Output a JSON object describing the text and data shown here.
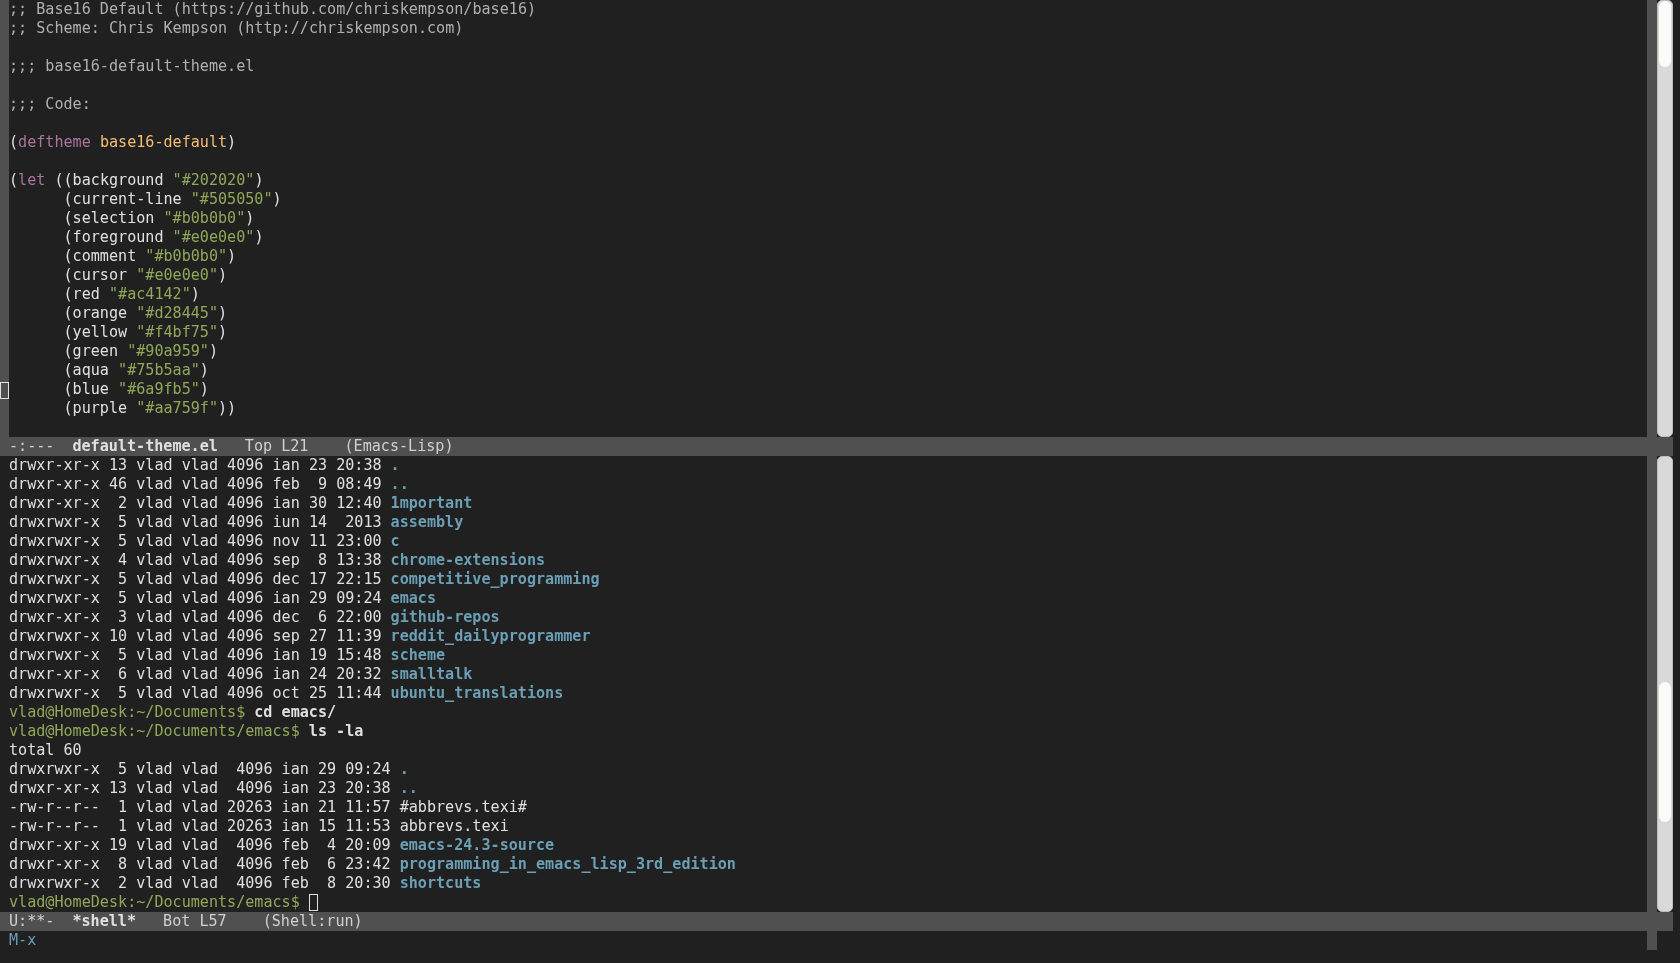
{
  "editor": {
    "lines": [
      {
        "kind": "code",
        "cursor": false,
        "segments": [
          {
            "kind": "comment",
            "text": ";; Base16 Default (https://github.com/chriskempson/base16)"
          }
        ]
      },
      {
        "kind": "code",
        "cursor": false,
        "segments": [
          {
            "kind": "comment",
            "text": ";; Scheme: Chris Kempson (http://chriskempson.com)"
          }
        ]
      },
      {
        "kind": "blank",
        "cursor": false
      },
      {
        "kind": "code",
        "cursor": false,
        "segments": [
          {
            "kind": "comment",
            "text": ";;; base16-default-theme.el"
          }
        ]
      },
      {
        "kind": "blank",
        "cursor": false
      },
      {
        "kind": "code",
        "cursor": false,
        "segments": [
          {
            "kind": "comment",
            "text": ";;; Code:"
          }
        ]
      },
      {
        "kind": "blank",
        "cursor": false
      },
      {
        "kind": "code",
        "cursor": false,
        "segments": [
          {
            "kind": "plain",
            "text": "("
          },
          {
            "kind": "keyword",
            "text": "deftheme"
          },
          {
            "kind": "name",
            "text": " base16-default"
          },
          {
            "kind": "plain",
            "text": ")"
          }
        ]
      },
      {
        "kind": "blank",
        "cursor": false
      },
      {
        "kind": "code",
        "cursor": false,
        "segments": [
          {
            "kind": "plain",
            "text": "("
          },
          {
            "kind": "keyword",
            "text": "let"
          },
          {
            "kind": "plain",
            "text": " ((background "
          },
          {
            "kind": "string",
            "text": "\"#202020\""
          },
          {
            "kind": "plain",
            "text": ")"
          }
        ]
      },
      {
        "kind": "code",
        "cursor": false,
        "segments": [
          {
            "kind": "plain",
            "text": "      (current-line "
          },
          {
            "kind": "string",
            "text": "\"#505050\""
          },
          {
            "kind": "plain",
            "text": ")"
          }
        ]
      },
      {
        "kind": "code",
        "cursor": false,
        "segments": [
          {
            "kind": "plain",
            "text": "      (selection "
          },
          {
            "kind": "string",
            "text": "\"#b0b0b0\""
          },
          {
            "kind": "plain",
            "text": ")"
          }
        ]
      },
      {
        "kind": "code",
        "cursor": false,
        "segments": [
          {
            "kind": "plain",
            "text": "      (foreground "
          },
          {
            "kind": "string",
            "text": "\"#e0e0e0\""
          },
          {
            "kind": "plain",
            "text": ")"
          }
        ]
      },
      {
        "kind": "code",
        "cursor": false,
        "segments": [
          {
            "kind": "plain",
            "text": "      (comment "
          },
          {
            "kind": "string",
            "text": "\"#b0b0b0\""
          },
          {
            "kind": "plain",
            "text": ")"
          }
        ]
      },
      {
        "kind": "code",
        "cursor": false,
        "segments": [
          {
            "kind": "plain",
            "text": "      (cursor "
          },
          {
            "kind": "string",
            "text": "\"#e0e0e0\""
          },
          {
            "kind": "plain",
            "text": ")"
          }
        ]
      },
      {
        "kind": "code",
        "cursor": false,
        "segments": [
          {
            "kind": "plain",
            "text": "      (red "
          },
          {
            "kind": "string",
            "text": "\"#ac4142\""
          },
          {
            "kind": "plain",
            "text": ")"
          }
        ]
      },
      {
        "kind": "code",
        "cursor": false,
        "segments": [
          {
            "kind": "plain",
            "text": "      (orange "
          },
          {
            "kind": "string",
            "text": "\"#d28445\""
          },
          {
            "kind": "plain",
            "text": ")"
          }
        ]
      },
      {
        "kind": "code",
        "cursor": false,
        "segments": [
          {
            "kind": "plain",
            "text": "      (yellow "
          },
          {
            "kind": "string",
            "text": "\"#f4bf75\""
          },
          {
            "kind": "plain",
            "text": ")"
          }
        ]
      },
      {
        "kind": "code",
        "cursor": false,
        "segments": [
          {
            "kind": "plain",
            "text": "      (green "
          },
          {
            "kind": "string",
            "text": "\"#90a959\""
          },
          {
            "kind": "plain",
            "text": ")"
          }
        ]
      },
      {
        "kind": "code",
        "cursor": false,
        "segments": [
          {
            "kind": "plain",
            "text": "      (aqua "
          },
          {
            "kind": "string",
            "text": "\"#75b5aa\""
          },
          {
            "kind": "plain",
            "text": ")"
          }
        ]
      },
      {
        "kind": "code",
        "cursor": true,
        "segments": [
          {
            "kind": "plain",
            "text": "      (blue "
          },
          {
            "kind": "string",
            "text": "\"#6a9fb5\""
          },
          {
            "kind": "plain",
            "text": ")"
          }
        ]
      },
      {
        "kind": "code",
        "cursor": false,
        "segments": [
          {
            "kind": "plain",
            "text": "      (purple "
          },
          {
            "kind": "string",
            "text": "\"#aa759f\""
          },
          {
            "kind": "plain",
            "text": "))"
          }
        ]
      }
    ],
    "mode_line": {
      "status": "-:---",
      "buffer": "default-theme.el",
      "position": "Top L21",
      "mode": "(Emacs-Lisp)"
    }
  },
  "shell": {
    "lines": [
      {
        "kind": "listing",
        "info": "drwxr-xr-x 13 vlad vlad 4096 ian 23 20:38",
        "name": ".",
        "is_directory": true
      },
      {
        "kind": "listing",
        "info": "drwxr-xr-x 46 vlad vlad 4096 feb  9 08:49",
        "name": "..",
        "is_directory": true
      },
      {
        "kind": "listing",
        "info": "drwxr-xr-x  2 vlad vlad 4096 ian 30 12:40",
        "name": "1mportant",
        "is_directory": true
      },
      {
        "kind": "listing",
        "info": "drwxrwxr-x  5 vlad vlad 4096 iun 14  2013",
        "name": "assembly",
        "is_directory": true
      },
      {
        "kind": "listing",
        "info": "drwxrwxr-x  5 vlad vlad 4096 nov 11 23:00",
        "name": "c",
        "is_directory": true
      },
      {
        "kind": "listing",
        "info": "drwxrwxr-x  4 vlad vlad 4096 sep  8 13:38",
        "name": "chrome-extensions",
        "is_directory": true
      },
      {
        "kind": "listing",
        "info": "drwxrwxr-x  5 vlad vlad 4096 dec 17 22:15",
        "name": "competitive_programming",
        "is_directory": true
      },
      {
        "kind": "listing",
        "info": "drwxrwxr-x  5 vlad vlad 4096 ian 29 09:24",
        "name": "emacs",
        "is_directory": true
      },
      {
        "kind": "listing",
        "info": "drwxr-xr-x  3 vlad vlad 4096 dec  6 22:00",
        "name": "github-repos",
        "is_directory": true
      },
      {
        "kind": "listing",
        "info": "drwxrwxr-x 10 vlad vlad 4096 sep 27 11:39",
        "name": "reddit_dailyprogrammer",
        "is_directory": true
      },
      {
        "kind": "listing",
        "info": "drwxrwxr-x  5 vlad vlad 4096 ian 19 15:48",
        "name": "scheme",
        "is_directory": true
      },
      {
        "kind": "listing",
        "info": "drwxr-xr-x  6 vlad vlad 4096 ian 24 20:32",
        "name": "smalltalk",
        "is_directory": true
      },
      {
        "kind": "listing",
        "info": "drwxrwxr-x  5 vlad vlad 4096 oct 25 11:44",
        "name": "ubuntu_translations",
        "is_directory": true
      },
      {
        "kind": "prompt",
        "prompt": "vlad@HomeDesk:~/Documents$",
        "command": "cd emacs/",
        "cursor": false
      },
      {
        "kind": "prompt",
        "prompt": "vlad@HomeDesk:~/Documents/emacs$",
        "command": "ls -la",
        "cursor": false
      },
      {
        "kind": "output",
        "text": "total 60"
      },
      {
        "kind": "listing",
        "info": "drwxrwxr-x  5 vlad vlad  4096 ian 29 09:24",
        "name": ".",
        "is_directory": true
      },
      {
        "kind": "listing",
        "info": "drwxr-xr-x 13 vlad vlad  4096 ian 23 20:38",
        "name": "..",
        "is_directory": true
      },
      {
        "kind": "listing",
        "info": "-rw-r--r--  1 vlad vlad 20263 ian 21 11:57",
        "name": "#abbrevs.texi#",
        "is_directory": false
      },
      {
        "kind": "listing",
        "info": "-rw-r--r--  1 vlad vlad 20263 ian 15 11:53",
        "name": "abbrevs.texi",
        "is_directory": false
      },
      {
        "kind": "listing",
        "info": "drwxr-xr-x 19 vlad vlad  4096 feb  4 20:09",
        "name": "emacs-24.3-source",
        "is_directory": true
      },
      {
        "kind": "listing",
        "info": "drwxr-xr-x  8 vlad vlad  4096 feb  6 23:42",
        "name": "programming_in_emacs_lisp_3rd_edition",
        "is_directory": true
      },
      {
        "kind": "listing",
        "info": "drwxrwxr-x  2 vlad vlad  4096 feb  8 20:30",
        "name": "shortcuts",
        "is_directory": true
      },
      {
        "kind": "prompt",
        "prompt": "vlad@HomeDesk:~/Documents/emacs$",
        "cursor": true
      }
    ],
    "mode_line": {
      "status": "U:**-",
      "buffer": "*shell*",
      "position": "Bot L57",
      "mode": "(Shell:run)"
    }
  },
  "minibuffer": {
    "text": "M-x"
  }
}
